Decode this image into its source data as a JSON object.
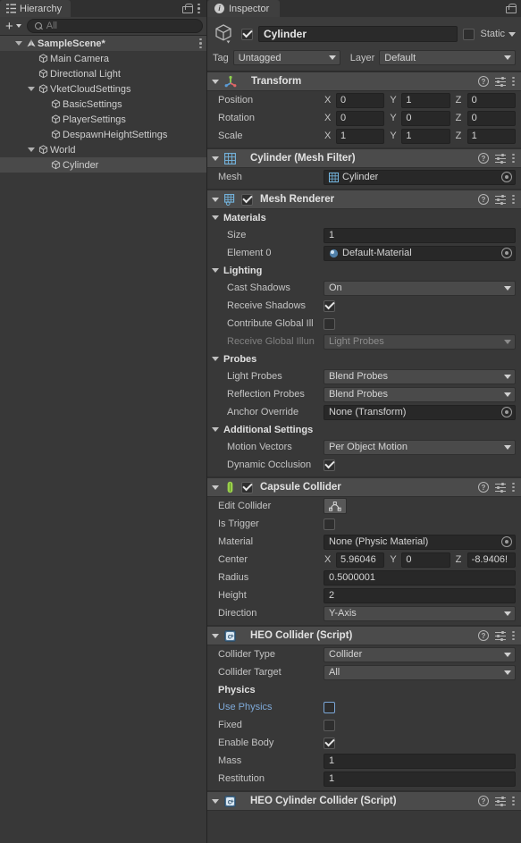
{
  "hierarchy": {
    "tab": {
      "label": "Hierarchy",
      "icon": "hierarchy-icon"
    },
    "lock_icon": "lock-icon",
    "menu_icon": "kebab-menu-icon",
    "toolbar": {
      "add_label": "+",
      "search_placeholder": "All",
      "search_value": ""
    },
    "items": [
      {
        "label": "SampleScene*",
        "depth": 0,
        "icon": "unity-scene-icon",
        "expanded": true,
        "selected": false,
        "scene": true
      },
      {
        "label": "Main Camera",
        "depth": 1,
        "icon": "gameobject-cube-icon",
        "expanded": null,
        "selected": false
      },
      {
        "label": "Directional Light",
        "depth": 1,
        "icon": "gameobject-cube-icon",
        "expanded": null,
        "selected": false
      },
      {
        "label": "VketCloudSettings",
        "depth": 1,
        "icon": "gameobject-cube-icon",
        "expanded": true,
        "selected": false
      },
      {
        "label": "BasicSettings",
        "depth": 2,
        "icon": "gameobject-cube-icon",
        "expanded": null,
        "selected": false
      },
      {
        "label": "PlayerSettings",
        "depth": 2,
        "icon": "gameobject-cube-icon",
        "expanded": null,
        "selected": false
      },
      {
        "label": "DespawnHeightSettings",
        "depth": 2,
        "icon": "gameobject-cube-icon",
        "expanded": null,
        "selected": false
      },
      {
        "label": "World",
        "depth": 1,
        "icon": "gameobject-cube-icon",
        "expanded": true,
        "selected": false
      },
      {
        "label": "Cylinder",
        "depth": 2,
        "icon": "gameobject-cube-icon",
        "expanded": null,
        "selected": true
      }
    ]
  },
  "inspector": {
    "tab": {
      "label": "Inspector",
      "icon": "info-icon"
    },
    "lock_icon": "lock-icon",
    "header": {
      "enabled": true,
      "name": "Cylinder",
      "static_checked": false,
      "static_label": "Static",
      "tag_label": "Tag",
      "tag_value": "Untagged",
      "layer_label": "Layer",
      "layer_value": "Default"
    },
    "components": [
      {
        "id": "transform",
        "title": "Transform",
        "icon": "transform-axis-icon",
        "has_checkbox": false,
        "rows": [
          {
            "type": "vec3",
            "label": "Position",
            "x": "0",
            "y": "1",
            "z": "0"
          },
          {
            "type": "vec3",
            "label": "Rotation",
            "x": "0",
            "y": "0",
            "z": "0"
          },
          {
            "type": "vec3",
            "label": "Scale",
            "x": "1",
            "y": "1",
            "z": "1"
          }
        ]
      },
      {
        "id": "mesh-filter",
        "title": "Cylinder (Mesh Filter)",
        "icon": "mesh-filter-icon",
        "has_checkbox": false,
        "rows": [
          {
            "type": "objref",
            "label": "Mesh",
            "value": "Cylinder",
            "value_icon": "mesh-icon"
          }
        ]
      },
      {
        "id": "mesh-renderer",
        "title": "Mesh Renderer",
        "icon": "mesh-renderer-icon",
        "has_checkbox": true,
        "checked": true,
        "rows": [
          {
            "type": "section",
            "label": "Materials"
          },
          {
            "type": "text",
            "label": "Size",
            "indent": true,
            "value": "1"
          },
          {
            "type": "objref",
            "label": "Element 0",
            "indent": true,
            "value": "Default-Material",
            "value_icon": "material-sphere-icon"
          },
          {
            "type": "section",
            "label": "Lighting"
          },
          {
            "type": "dropdown",
            "label": "Cast Shadows",
            "indent": true,
            "value": "On"
          },
          {
            "type": "checkbox",
            "label": "Receive Shadows",
            "indent": true,
            "checked": true
          },
          {
            "type": "checkbox",
            "label": "Contribute Global Ill",
            "indent": true,
            "checked": false
          },
          {
            "type": "dropdown",
            "label": "Receive Global Illun",
            "indent": true,
            "value": "Light Probes",
            "disabled": true
          },
          {
            "type": "section",
            "label": "Probes"
          },
          {
            "type": "dropdown",
            "label": "Light Probes",
            "indent": true,
            "value": "Blend Probes"
          },
          {
            "type": "dropdown",
            "label": "Reflection Probes",
            "indent": true,
            "value": "Blend Probes"
          },
          {
            "type": "objref",
            "label": "Anchor Override",
            "indent": true,
            "value": "None (Transform)"
          },
          {
            "type": "section",
            "label": "Additional Settings"
          },
          {
            "type": "dropdown",
            "label": "Motion Vectors",
            "indent": true,
            "value": "Per Object Motion"
          },
          {
            "type": "checkbox",
            "label": "Dynamic Occlusion",
            "indent": true,
            "checked": true
          }
        ]
      },
      {
        "id": "capsule-collider",
        "title": "Capsule Collider",
        "icon": "capsule-collider-icon",
        "has_checkbox": true,
        "checked": true,
        "rows": [
          {
            "type": "button",
            "label": "Edit Collider",
            "button_icon": "edit-collider-icon"
          },
          {
            "type": "checkbox",
            "label": "Is Trigger",
            "checked": false
          },
          {
            "type": "objref",
            "label": "Material",
            "value": "None (Physic Material)"
          },
          {
            "type": "vec3",
            "label": "Center",
            "x": "5.96046",
            "y": "0",
            "z": "-8.9406!"
          },
          {
            "type": "text",
            "label": "Radius",
            "value": "0.5000001"
          },
          {
            "type": "text",
            "label": "Height",
            "value": "2"
          },
          {
            "type": "dropdown",
            "label": "Direction",
            "value": "Y-Axis"
          }
        ]
      },
      {
        "id": "heo-collider",
        "title": "HEO Collider (Script)",
        "icon": "csharp-script-icon",
        "has_checkbox": false,
        "rows": [
          {
            "type": "dropdown",
            "label": "Collider Type",
            "value": "Collider"
          },
          {
            "type": "dropdown",
            "label": "Collider Target",
            "value": "All"
          },
          {
            "type": "subsection",
            "label": "Physics"
          },
          {
            "type": "checkbox",
            "label": "Use Physics",
            "checked": false,
            "blue": true,
            "blue_box": true
          },
          {
            "type": "checkbox",
            "label": "Fixed",
            "checked": false
          },
          {
            "type": "checkbox",
            "label": "Enable Body",
            "checked": true
          },
          {
            "type": "text",
            "label": "Mass",
            "value": "1"
          },
          {
            "type": "text",
            "label": "Restitution",
            "value": "1"
          }
        ]
      },
      {
        "id": "heo-cylinder-collider",
        "title": "HEO Cylinder Collider (Script)",
        "icon": "csharp-script-icon",
        "has_checkbox": false,
        "rows": []
      }
    ],
    "header_icons": {
      "help": "help-icon",
      "preset": "preset-icon",
      "menu": "kebab-menu-icon"
    }
  },
  "colors": {
    "panel_bg": "#383838",
    "header_bg": "#4b4b4b",
    "field_bg": "#282828",
    "dropdown_bg": "#4a4a4a",
    "selection": "#4a4a4a",
    "accent_blue": "#7ea9d8",
    "collider_green": "#9ad14b"
  }
}
